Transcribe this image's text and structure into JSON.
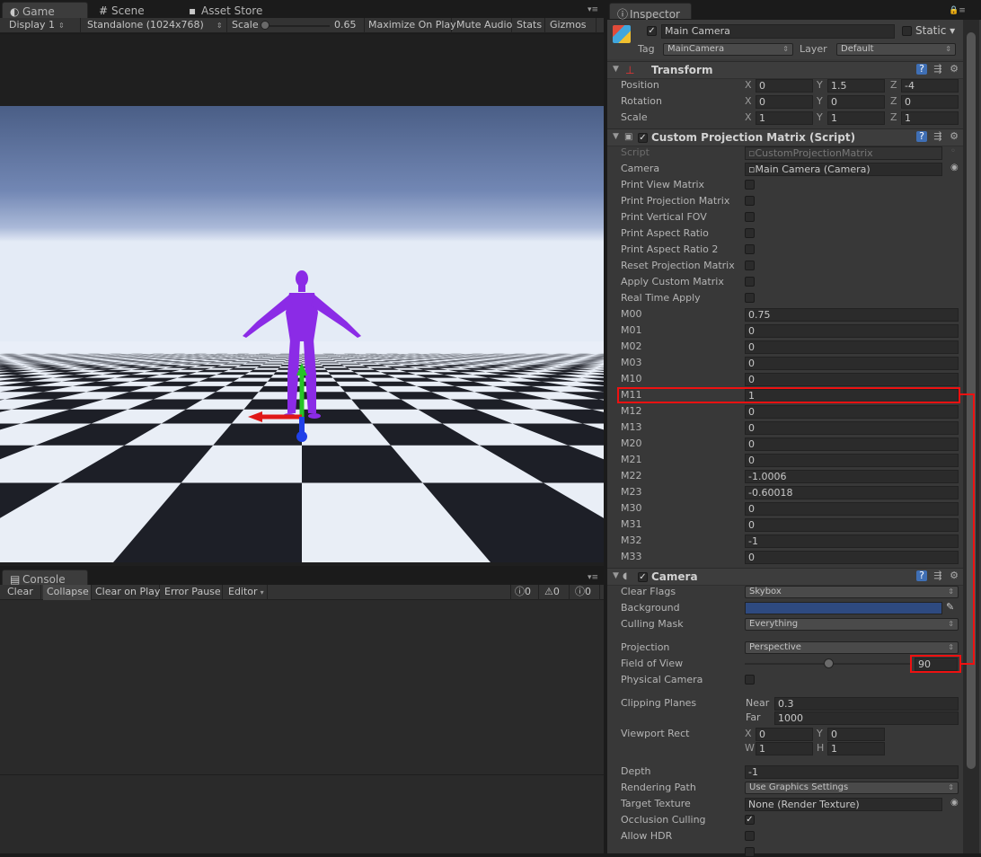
{
  "left_tabs": [
    {
      "label": "Game",
      "icon": "game-icon",
      "glyph": "◐"
    },
    {
      "label": "Scene",
      "icon": "scene-grid-icon",
      "glyph": "#"
    },
    {
      "label": "Asset Store",
      "icon": "asset-store-icon",
      "glyph": "▪"
    }
  ],
  "game_toolbar": {
    "display": "Display 1",
    "resolution": "Standalone (1024x768)",
    "scale_label": "Scale",
    "scale_value": "0.65",
    "maximize": "Maximize On Play",
    "mute": "Mute Audio",
    "stats": "Stats",
    "gizmos": "Gizmos"
  },
  "console": {
    "tab": "Console",
    "clear": "Clear",
    "collapse": "Collapse",
    "clear_on_play": "Clear on Play",
    "error_pause": "Error Pause",
    "editor": "Editor",
    "counts": {
      "info": "0",
      "warnings": "0",
      "errors": "0"
    }
  },
  "inspector": {
    "tab": "Inspector",
    "object_name": "Main Camera",
    "static_label": "Static",
    "tag_label": "Tag",
    "tag_value": "MainCamera",
    "layer_label": "Layer",
    "layer_value": "Default",
    "transform": {
      "title": "Transform",
      "rows": [
        {
          "label": "Position",
          "x": "0",
          "y": "1.5",
          "z": "-4"
        },
        {
          "label": "Rotation",
          "x": "0",
          "y": "0",
          "z": "0"
        },
        {
          "label": "Scale",
          "x": "1",
          "y": "1",
          "z": "1"
        }
      ]
    },
    "script": {
      "title": "Custom Projection Matrix (Script)",
      "script_label": "Script",
      "script_value": "CustomProjectionMatrix",
      "camera_label": "Camera",
      "camera_value": "Main Camera (Camera)",
      "toggles": [
        "Print View Matrix",
        "Print Projection Matrix",
        "Print Vertical FOV",
        "Print Aspect Ratio",
        "Print Aspect Ratio 2",
        "Reset Projection Matrix",
        "Apply Custom Matrix",
        "Real Time Apply"
      ],
      "matrix": [
        {
          "label": "M00",
          "value": "0.75"
        },
        {
          "label": "M01",
          "value": "0"
        },
        {
          "label": "M02",
          "value": "0"
        },
        {
          "label": "M03",
          "value": "0"
        },
        {
          "label": "M10",
          "value": "0"
        },
        {
          "label": "M11",
          "value": "1"
        },
        {
          "label": "M12",
          "value": "0"
        },
        {
          "label": "M13",
          "value": "0"
        },
        {
          "label": "M20",
          "value": "0"
        },
        {
          "label": "M21",
          "value": "0"
        },
        {
          "label": "M22",
          "value": "-1.0006"
        },
        {
          "label": "M23",
          "value": "-0.60018"
        },
        {
          "label": "M30",
          "value": "0"
        },
        {
          "label": "M31",
          "value": "0"
        },
        {
          "label": "M32",
          "value": "-1"
        },
        {
          "label": "M33",
          "value": "0"
        }
      ]
    },
    "camera": {
      "title": "Camera",
      "clear_flags_label": "Clear Flags",
      "clear_flags_value": "Skybox",
      "background_label": "Background",
      "background_color": "#2e4a80",
      "culling_mask_label": "Culling Mask",
      "culling_mask_value": "Everything",
      "projection_label": "Projection",
      "projection_value": "Perspective",
      "fov_label": "Field of View",
      "fov_value": "90",
      "fov_fraction": 0.5,
      "physical_label": "Physical Camera",
      "clipping_label": "Clipping Planes",
      "near_label": "Near",
      "near_value": "0.3",
      "far_label": "Far",
      "far_value": "1000",
      "viewport_label": "Viewport Rect",
      "vp_x": "0",
      "vp_y": "0",
      "vp_w": "1",
      "vp_h": "1",
      "depth_label": "Depth",
      "depth_value": "-1",
      "rendering_path_label": "Rendering Path",
      "rendering_path_value": "Use Graphics Settings",
      "target_texture_label": "Target Texture",
      "target_texture_value": "None (Render Texture)",
      "occlusion_label": "Occlusion Culling",
      "hdr_label": "Allow HDR"
    }
  },
  "colors": {
    "highlight_red": "#e11111",
    "figure": "#8a2be2"
  }
}
